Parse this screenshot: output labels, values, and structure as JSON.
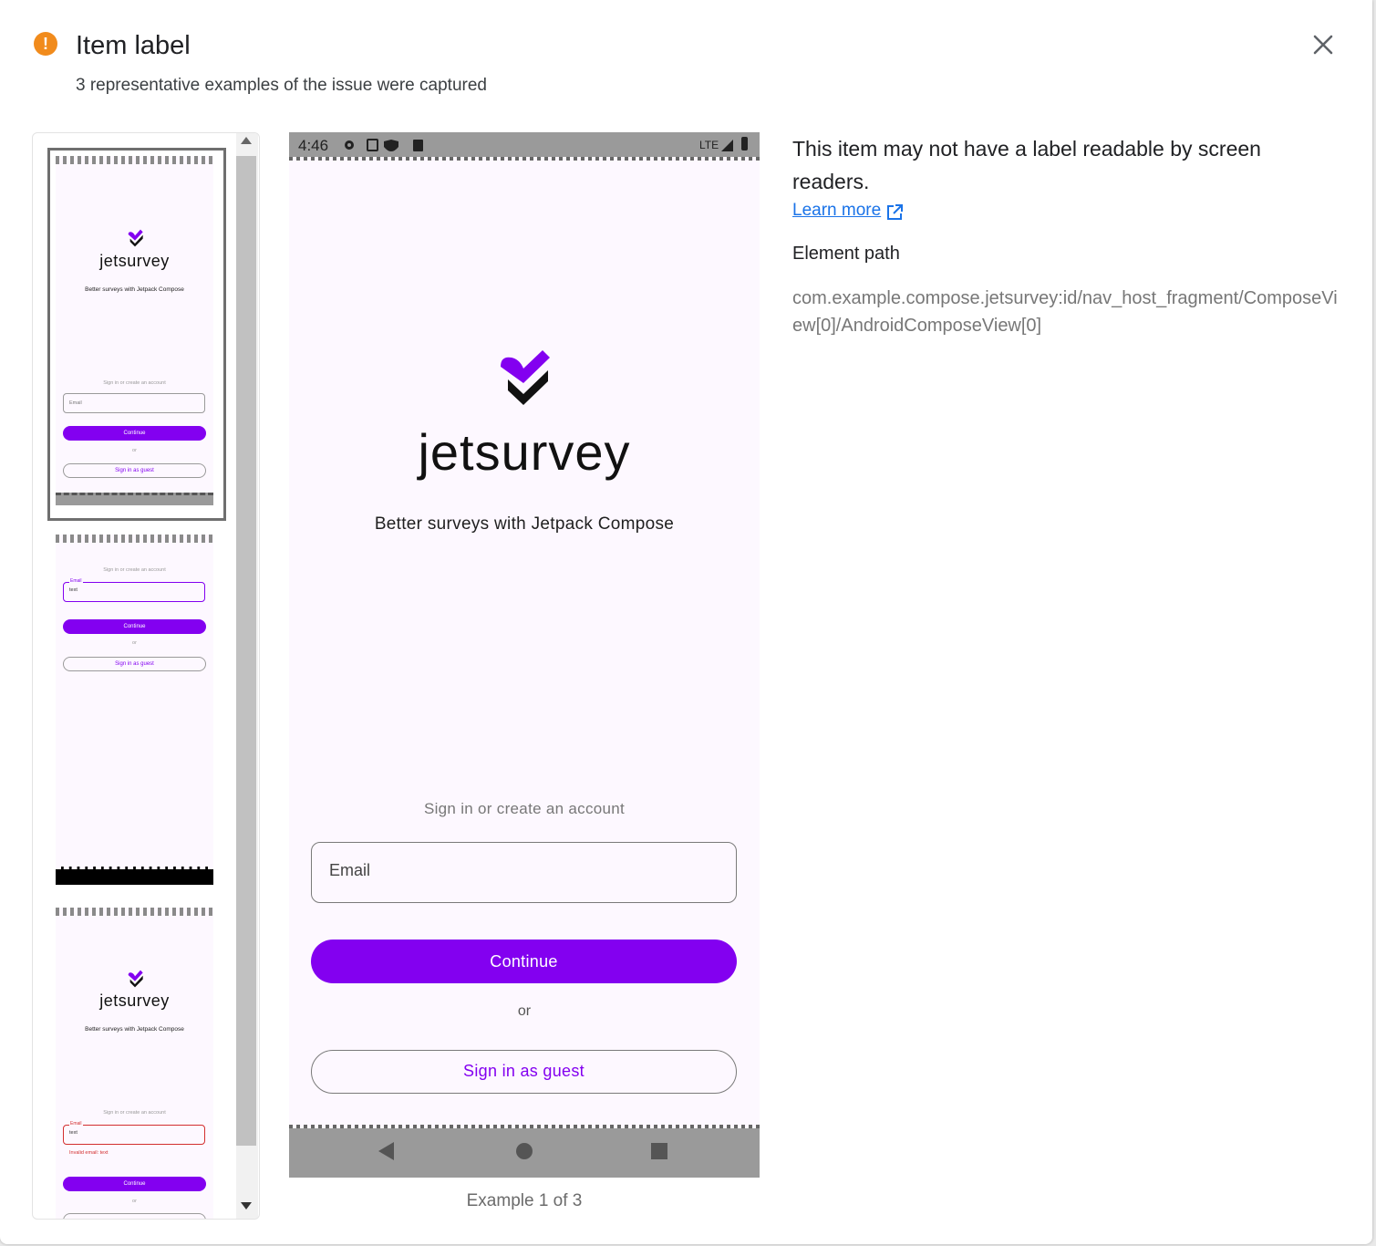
{
  "dialog": {
    "title": "Item label",
    "subtitle": "3 representative examples of the issue were captured",
    "warning_icon": "!",
    "close_icon": "close-icon"
  },
  "thumbnails": [
    {
      "logo": "jetsurvey",
      "tagline": "Better surveys with Jetpack Compose",
      "prompt": "Sign in or create an account",
      "email_label": "Email",
      "continue": "Continue",
      "or": "or",
      "guest": "Sign in as guest"
    },
    {
      "prompt": "Sign in or create an account",
      "email_label": "Email",
      "email_value": "text",
      "continue": "Continue",
      "or": "or",
      "guest": "Sign in as guest"
    },
    {
      "logo": "jetsurvey",
      "tagline": "Better surveys with Jetpack Compose",
      "prompt": "Sign in or create an account",
      "email_label": "Email",
      "email_value": "text",
      "error": "Invalid email: text",
      "continue": "Continue",
      "or": "or"
    }
  ],
  "preview": {
    "time": "4:46",
    "network": "LTE",
    "logo": "jetsurvey",
    "tagline": "Better surveys with Jetpack Compose",
    "prompt": "Sign in or create an account",
    "email_label": "Email",
    "continue": "Continue",
    "or": "or",
    "guest": "Sign in as guest",
    "caption": "Example 1 of 3"
  },
  "info": {
    "description": "This item may not have a label readable by screen readers.",
    "learn_more": "Learn more",
    "path_heading": "Element path",
    "path_value": "com.example.compose.jetsurvey:id/nav_host_fragment/ComposeView[0]/AndroidComposeView[0]"
  },
  "colors": {
    "accent": "#8300f0",
    "warning": "#f18b1c",
    "link": "#1a73e8",
    "error": "#d32f2f"
  }
}
